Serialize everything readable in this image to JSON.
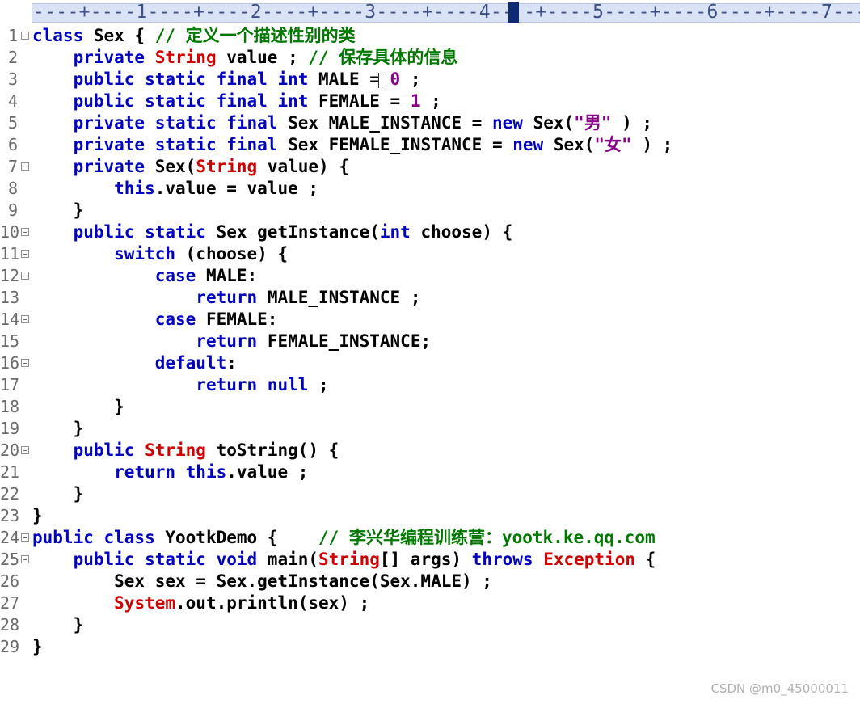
{
  "ruler": {
    "text": "----+----1----+----2----+----3----+----4--",
    "text_after": "-+----5----+----6----+----7---"
  },
  "lines": [
    {
      "n": "1",
      "fold": true,
      "tokens": [
        [
          "kw",
          "class "
        ],
        [
          "",
          "Sex { "
        ],
        [
          "cm",
          "// 定义一个描述性别的类"
        ]
      ]
    },
    {
      "n": "2",
      "fold": false,
      "tokens": [
        [
          "",
          "    "
        ],
        [
          "kw",
          "private "
        ],
        [
          "ty",
          "String"
        ],
        [
          "",
          " value ; "
        ],
        [
          "cm",
          "// 保存具体的信息"
        ]
      ]
    },
    {
      "n": "3",
      "fold": false,
      "tokens": [
        [
          "",
          "    "
        ],
        [
          "kw",
          "public static final int "
        ],
        [
          "",
          "MALE = "
        ],
        [
          "nm",
          "0"
        ],
        [
          "",
          " ;"
        ]
      ]
    },
    {
      "n": "4",
      "fold": false,
      "tokens": [
        [
          "",
          "    "
        ],
        [
          "kw",
          "public static final int "
        ],
        [
          "",
          "FEMALE = "
        ],
        [
          "nm",
          "1"
        ],
        [
          "",
          " ;"
        ]
      ]
    },
    {
      "n": "5",
      "fold": false,
      "tokens": [
        [
          "",
          "    "
        ],
        [
          "kw",
          "private static final "
        ],
        [
          "",
          "Sex MALE_INSTANCE = "
        ],
        [
          "kw",
          "new "
        ],
        [
          "",
          "Sex("
        ],
        [
          "st",
          "\"男\""
        ],
        [
          "",
          " ) ;"
        ]
      ]
    },
    {
      "n": "6",
      "fold": false,
      "tokens": [
        [
          "",
          "    "
        ],
        [
          "kw",
          "private static final "
        ],
        [
          "",
          "Sex FEMALE_INSTANCE = "
        ],
        [
          "kw",
          "new "
        ],
        [
          "",
          "Sex("
        ],
        [
          "st",
          "\"女\""
        ],
        [
          "",
          " ) ;"
        ]
      ]
    },
    {
      "n": "7",
      "fold": true,
      "tokens": [
        [
          "",
          "    "
        ],
        [
          "kw",
          "private "
        ],
        [
          "",
          "Sex("
        ],
        [
          "ty",
          "String"
        ],
        [
          "",
          " value) {"
        ]
      ]
    },
    {
      "n": "8",
      "fold": false,
      "tokens": [
        [
          "",
          "        "
        ],
        [
          "kw",
          "this"
        ],
        [
          "",
          ".value = value ;"
        ]
      ]
    },
    {
      "n": "9",
      "fold": false,
      "tokens": [
        [
          "",
          "    }"
        ]
      ]
    },
    {
      "n": "10",
      "fold": true,
      "tokens": [
        [
          "",
          "    "
        ],
        [
          "kw",
          "public static "
        ],
        [
          "",
          "Sex getInstance("
        ],
        [
          "kw",
          "int "
        ],
        [
          "",
          "choose) {"
        ]
      ]
    },
    {
      "n": "11",
      "fold": true,
      "tokens": [
        [
          "",
          "        "
        ],
        [
          "kw",
          "switch "
        ],
        [
          "",
          "(choose) {"
        ]
      ]
    },
    {
      "n": "12",
      "fold": true,
      "tokens": [
        [
          "",
          "            "
        ],
        [
          "kw",
          "case "
        ],
        [
          "",
          "MALE:"
        ]
      ]
    },
    {
      "n": "13",
      "fold": false,
      "tokens": [
        [
          "",
          "                "
        ],
        [
          "kw",
          "return "
        ],
        [
          "",
          "MALE_INSTANCE ;"
        ]
      ]
    },
    {
      "n": "14",
      "fold": true,
      "tokens": [
        [
          "",
          "            "
        ],
        [
          "kw",
          "case "
        ],
        [
          "",
          "FEMALE:"
        ]
      ]
    },
    {
      "n": "15",
      "fold": false,
      "tokens": [
        [
          "",
          "                "
        ],
        [
          "kw",
          "return "
        ],
        [
          "",
          "FEMALE_INSTANCE;"
        ]
      ]
    },
    {
      "n": "16",
      "fold": true,
      "tokens": [
        [
          "",
          "            "
        ],
        [
          "kw",
          "default"
        ],
        [
          "",
          ":"
        ]
      ]
    },
    {
      "n": "17",
      "fold": false,
      "tokens": [
        [
          "",
          "                "
        ],
        [
          "kw",
          "return null "
        ],
        [
          "",
          ";"
        ]
      ]
    },
    {
      "n": "18",
      "fold": false,
      "tokens": [
        [
          "",
          "        }"
        ]
      ]
    },
    {
      "n": "19",
      "fold": false,
      "tokens": [
        [
          "",
          "    }"
        ]
      ]
    },
    {
      "n": "20",
      "fold": true,
      "tokens": [
        [
          "",
          "    "
        ],
        [
          "kw",
          "public "
        ],
        [
          "ty",
          "String"
        ],
        [
          "",
          " toString() {"
        ]
      ]
    },
    {
      "n": "21",
      "fold": false,
      "tokens": [
        [
          "",
          "        "
        ],
        [
          "kw",
          "return this"
        ],
        [
          "",
          ".value ;"
        ]
      ]
    },
    {
      "n": "22",
      "fold": false,
      "tokens": [
        [
          "",
          "    }"
        ]
      ]
    },
    {
      "n": "23",
      "fold": false,
      "tokens": [
        [
          "",
          "}"
        ]
      ]
    },
    {
      "n": "24",
      "fold": true,
      "tokens": [
        [
          "kw",
          "public class "
        ],
        [
          "",
          "YootkDemo {    "
        ],
        [
          "cm",
          "// 李兴华编程训练营：yootk.ke.qq.com"
        ]
      ]
    },
    {
      "n": "25",
      "fold": true,
      "tokens": [
        [
          "",
          "    "
        ],
        [
          "kw",
          "public static void "
        ],
        [
          "",
          "main("
        ],
        [
          "ty",
          "String"
        ],
        [
          "",
          "[] args) "
        ],
        [
          "kw",
          "throws "
        ],
        [
          "ty",
          "Exception"
        ],
        [
          "",
          " {"
        ]
      ]
    },
    {
      "n": "26",
      "fold": false,
      "tokens": [
        [
          "",
          "        Sex sex = Sex.getInstance(Sex.MALE) ;"
        ]
      ]
    },
    {
      "n": "27",
      "fold": false,
      "tokens": [
        [
          "",
          "        "
        ],
        [
          "ty",
          "System"
        ],
        [
          "",
          ".out.println(sex) ;"
        ]
      ]
    },
    {
      "n": "28",
      "fold": false,
      "tokens": [
        [
          "",
          "    }"
        ]
      ]
    },
    {
      "n": "29",
      "fold": false,
      "tokens": [
        [
          "",
          "}"
        ]
      ]
    }
  ],
  "watermark": "CSDN @m0_45000011"
}
